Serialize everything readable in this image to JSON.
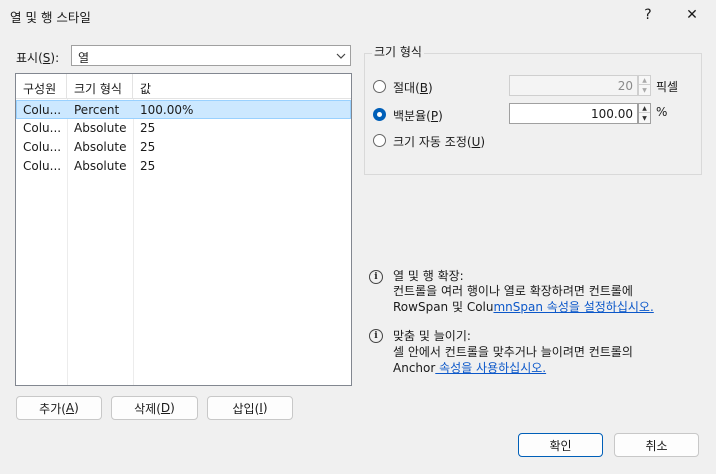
{
  "window": {
    "title": "열 및 행 스타일",
    "help_glyph": "?",
    "close_glyph": "✕"
  },
  "show": {
    "label_prefix": "표시(",
    "label_key": "S",
    "label_suffix": "):",
    "value": "열"
  },
  "list": {
    "columns": [
      "구성원",
      "크기 형식",
      "값"
    ],
    "rows": [
      {
        "member": "Colu...",
        "size_type": "Percent",
        "value": "100.00%",
        "selected": true
      },
      {
        "member": "Colu...",
        "size_type": "Absolute",
        "value": "25",
        "selected": false
      },
      {
        "member": "Colu...",
        "size_type": "Absolute",
        "value": "25",
        "selected": false
      },
      {
        "member": "Colu...",
        "size_type": "Absolute",
        "value": "25",
        "selected": false
      }
    ]
  },
  "buttons": {
    "add": {
      "prefix": "추가(",
      "key": "A",
      "suffix": ")"
    },
    "delete": {
      "prefix": "삭제(",
      "key": "D",
      "suffix": ")"
    },
    "insert": {
      "prefix": "삽입(",
      "key": "I",
      "suffix": ")"
    },
    "ok": "확인",
    "cancel": "취소"
  },
  "size_type": {
    "group_title": "크기 형식",
    "absolute": {
      "prefix": "절대(",
      "key": "B",
      "suffix": ")",
      "value": "20",
      "unit": "픽셀",
      "enabled": false
    },
    "percent": {
      "prefix": "백분율(",
      "key": "P",
      "suffix": ")",
      "value": "100.00",
      "unit": "%",
      "checked": true
    },
    "autosize": {
      "prefix": "크기 자동 조정(",
      "key": "U",
      "suffix": ")"
    }
  },
  "info": [
    {
      "icon": "info-icon",
      "title": "열 및 행 확장:",
      "line1": "컨트롤을 여러 행이나 열로 확장하려면 컨트롤에",
      "line2_plain": "RowSpan 및 Colu",
      "line2_link": "mnSpan 속성을 설정하십시오."
    },
    {
      "icon": "info-icon",
      "title": "맞춤 및 늘이기:",
      "line1": "셀 안에서 컨트롤을 맞추거나 늘이려면 컨트롤의",
      "line2_plain": "Anchor",
      "line2_link": " 속성을 사용하십시오."
    }
  ]
}
